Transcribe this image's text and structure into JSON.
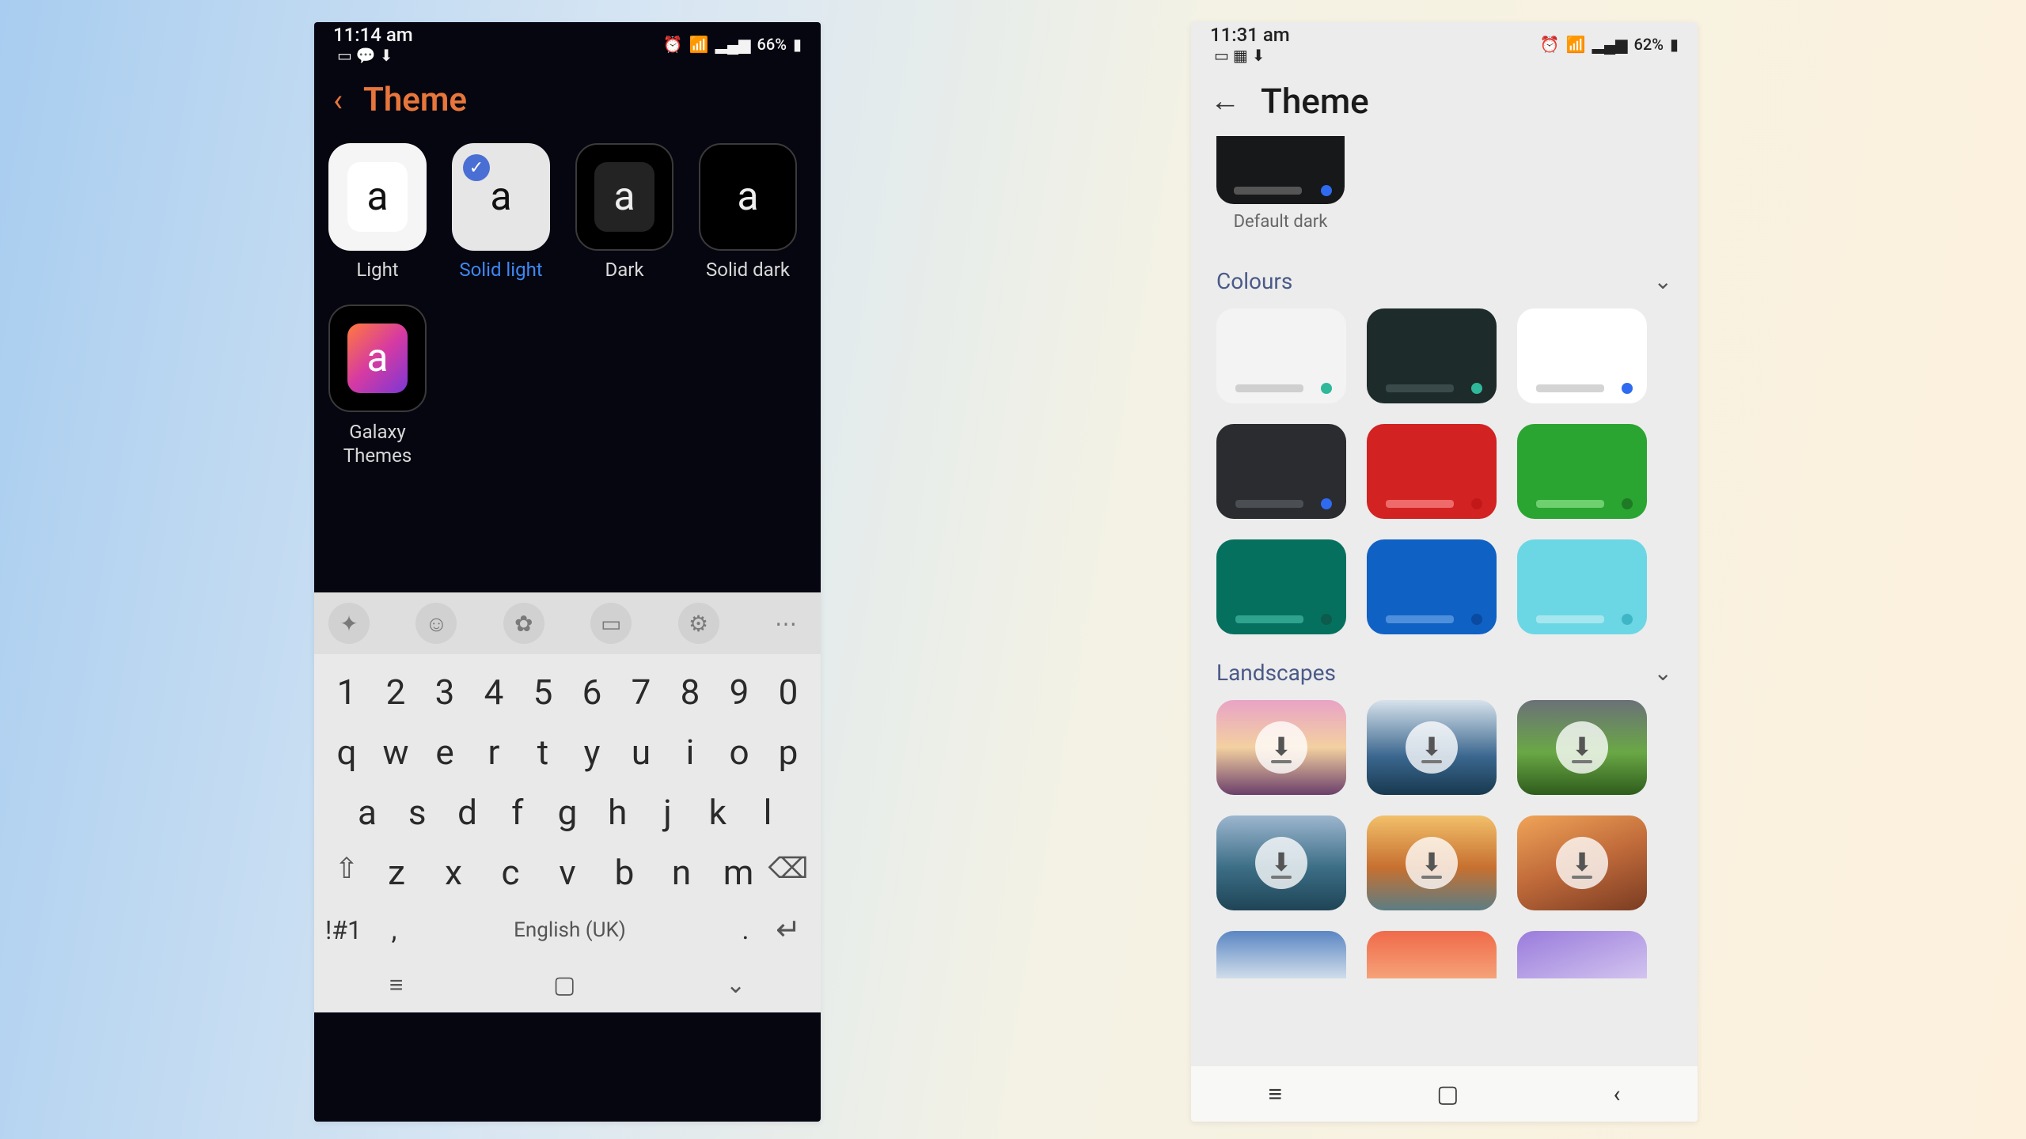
{
  "left": {
    "status": {
      "time": "11:14 am",
      "battery": "66%"
    },
    "header": {
      "title": "Theme"
    },
    "themes": [
      {
        "id": "light",
        "label": "Light",
        "selected": false
      },
      {
        "id": "solid-light",
        "label": "Solid light",
        "selected": true
      },
      {
        "id": "dark",
        "label": "Dark",
        "selected": false
      },
      {
        "id": "solid-dark",
        "label": "Solid dark",
        "selected": false
      },
      {
        "id": "galaxy",
        "label": "Galaxy Themes",
        "selected": false
      }
    ],
    "keyboard": {
      "row_num": [
        "1",
        "2",
        "3",
        "4",
        "5",
        "6",
        "7",
        "8",
        "9",
        "0"
      ],
      "row1": [
        "q",
        "w",
        "e",
        "r",
        "t",
        "y",
        "u",
        "i",
        "o",
        "p"
      ],
      "row2": [
        "a",
        "s",
        "d",
        "f",
        "g",
        "h",
        "j",
        "k",
        "l"
      ],
      "row3": [
        "z",
        "x",
        "c",
        "v",
        "b",
        "n",
        "m"
      ],
      "sym": "!#1",
      "lang": "English (UK)"
    }
  },
  "right": {
    "status": {
      "time": "11:31 am",
      "battery": "62%"
    },
    "header": {
      "title": "Theme"
    },
    "default_dark_label": "Default dark",
    "sections": {
      "colours": {
        "title": "Colours",
        "items": [
          {
            "bg": "#f3f3f3",
            "bar": "#cfcfcf",
            "dot": "#2fb89a"
          },
          {
            "bg": "#1e2b2b",
            "bar": "#3a4a4a",
            "dot": "#2fb89a"
          },
          {
            "bg": "#ffffff",
            "bar": "#d4d4d4",
            "dot": "#2f6bf0"
          },
          {
            "bg": "#2a2c2f",
            "bar": "#4b4e52",
            "dot": "#2f6bf0"
          },
          {
            "bg": "#d32222",
            "bar": "#ef6a6a",
            "dot": "#c21818"
          },
          {
            "bg": "#2aa531",
            "bar": "#6fd06f",
            "dot": "#1e7a24"
          },
          {
            "bg": "#06705e",
            "bar": "#2fa38d",
            "dot": "#0d5b4c"
          },
          {
            "bg": "#0f61c4",
            "bar": "#4e8fdc",
            "dot": "#0a4aa0"
          },
          {
            "bg": "#6cd7e4",
            "bar": "#a6e7ef",
            "dot": "#3fb6c6"
          }
        ]
      },
      "landscapes": {
        "title": "Landscapes",
        "items": [
          {
            "bg": "linear-gradient(180deg,#e9a3c6,#f3d0a0 50%,#6b3f6b)"
          },
          {
            "bg": "linear-gradient(180deg,#d7e2ec,#3a668e 60%,#18394f)"
          },
          {
            "bg": "linear-gradient(180deg,#6b7178,#6aa845 55%,#2e5c1c)"
          },
          {
            "bg": "linear-gradient(180deg,#9db6cf,#3c6e86 55%,#1f4456)"
          },
          {
            "bg": "linear-gradient(180deg,#f2c06a,#c77030 55%,#5c7d84)"
          },
          {
            "bg": "linear-gradient(160deg,#f0a458,#c06a3a 50%,#7a3c22)"
          },
          {
            "bg": "linear-gradient(180deg,#5a86c3,#d0ddea)"
          },
          {
            "bg": "linear-gradient(180deg,#f06a4a,#f5a278)"
          },
          {
            "bg": "linear-gradient(160deg,#9a7bdc,#d2c4ef)"
          }
        ]
      }
    }
  }
}
